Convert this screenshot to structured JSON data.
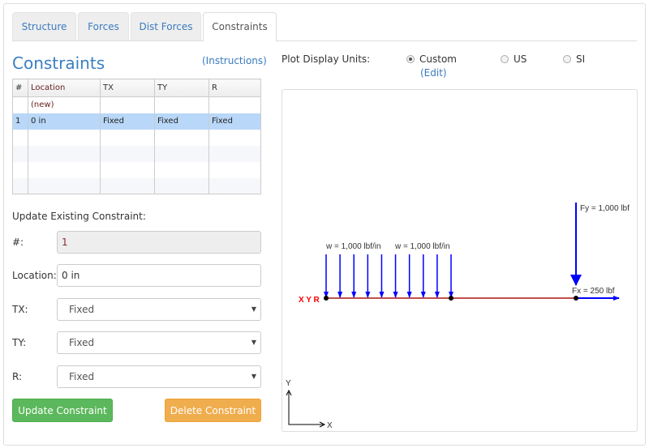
{
  "tabs": [
    "Structure",
    "Forces",
    "Dist Forces",
    "Constraints"
  ],
  "title": "Constraints",
  "instructions": "(Instructions)",
  "table": {
    "headers": [
      "#",
      "Location",
      "TX",
      "TY",
      "R"
    ],
    "rows": [
      [
        "",
        "(new)",
        "",
        "",
        ""
      ],
      [
        "1",
        "0 in",
        "Fixed",
        "Fixed",
        "Fixed"
      ]
    ]
  },
  "form": {
    "heading": "Update Existing Constraint:",
    "num_label": "#:",
    "num_value": "1",
    "location_label": "Location:",
    "location_value": "0 in",
    "tx_label": "TX:",
    "tx_value": "Fixed",
    "ty_label": "TY:",
    "ty_value": "Fixed",
    "r_label": "R:",
    "r_value": "Fixed",
    "update_label": "Update Constraint",
    "delete_label": "Delete Constraint"
  },
  "units": {
    "label": "Plot Display Units:",
    "options": [
      "Custom",
      "US",
      "SI"
    ],
    "selected": "Custom",
    "edit": "(Edit)"
  },
  "plot": {
    "dist_labels": [
      "w = 1,000 lbf/in",
      "w = 1,000 lbf/in"
    ],
    "fy_label": "Fy = 1,000 lbf",
    "fx_label": "Fx = 250 lbf",
    "constraint_label": "X Y R",
    "axis_x": "X",
    "axis_y": "Y",
    "colors": {
      "beam": "#c0504d",
      "force": "#0000ff",
      "constraint": "#ff0000",
      "node": "#000000"
    }
  }
}
